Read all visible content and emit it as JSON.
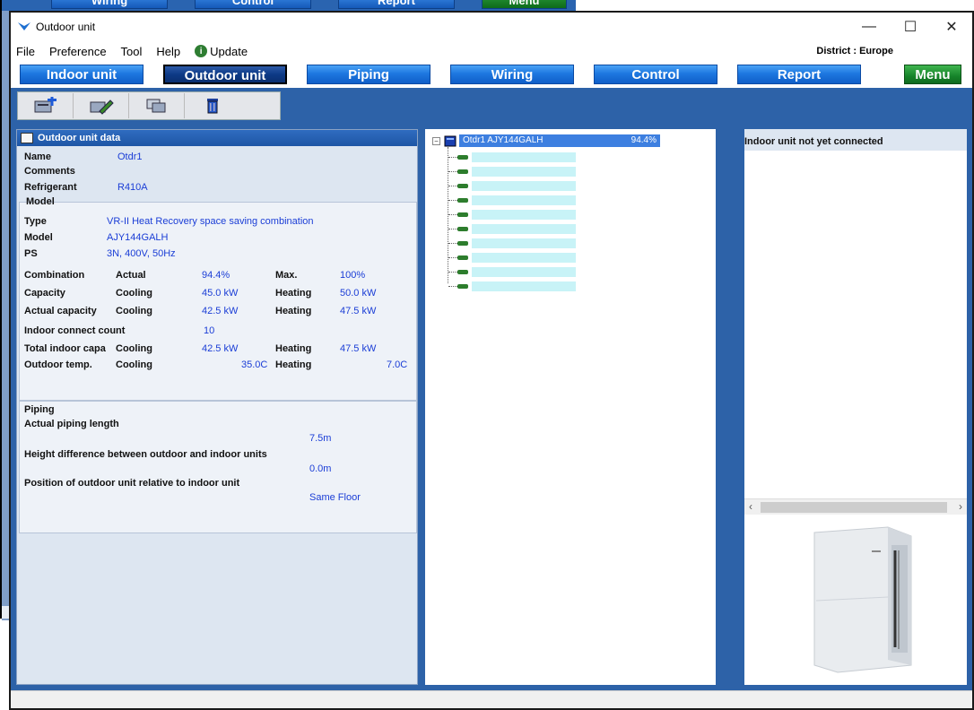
{
  "window": {
    "title": "Outdoor unit",
    "controls": {
      "minimize": "—",
      "maximize": "☐",
      "close": "✕"
    }
  },
  "menubar": {
    "items": [
      "File",
      "Preference",
      "Tool",
      "Help"
    ],
    "update_label": "Update",
    "district": "District : Europe"
  },
  "navbar": {
    "tabs": [
      "Indoor unit",
      "Outdoor unit",
      "Piping",
      "Wiring",
      "Control",
      "Report",
      "Menu"
    ],
    "active": "Outdoor unit"
  },
  "background_window": {
    "buttons": [
      "Wiring",
      "Control",
      "Report",
      "Menu"
    ]
  },
  "toolbar": {
    "icons": [
      "add-unit-icon",
      "edit-unit-icon",
      "copy-unit-icon",
      "delete-icon"
    ]
  },
  "outdoor_data": {
    "header": "Outdoor unit data",
    "name_label": "Name",
    "name_value": "Otdr1",
    "comments_label": "Comments",
    "refrigerant_label": "Refrigerant",
    "refrigerant_value": "R410A",
    "model_section": "Model",
    "type_label": "Type",
    "type_value": "VR-II Heat Recovery space saving combination",
    "model_label": "Model",
    "model_value": "AJY144GALH",
    "ps_label": "PS",
    "ps_value": "3N, 400V, 50Hz",
    "combination_label": "Combination",
    "actual_label": "Actual",
    "combination_actual": "94.4%",
    "max_label": "Max.",
    "combination_max": "100%",
    "capacity_label": "Capacity",
    "cooling_label": "Cooling",
    "capacity_cooling": "45.0 kW",
    "heating_label": "Heating",
    "capacity_heating": "50.0 kW",
    "actual_capacity_label": "Actual capacity",
    "actual_capacity_cooling": "42.5 kW",
    "actual_capacity_heating": "47.5 kW",
    "indoor_count_label": "Indoor connect count",
    "indoor_count_value": "10",
    "total_indoor_label": "Total indoor capa",
    "total_indoor_cooling": "42.5 kW",
    "total_indoor_heating": "47.5 kW",
    "outdoor_temp_label": "Outdoor temp.",
    "outdoor_temp_cooling": "35.0C",
    "outdoor_temp_heating": "7.0C"
  },
  "piping": {
    "section": "Piping",
    "length_label": "Actual piping length",
    "length_value": "7.5m",
    "height_label": "Height difference between outdoor and indoor units",
    "height_value": "0.0m",
    "position_label": "Position of outdoor unit relative to indoor unit",
    "position_value": "Same Floor"
  },
  "tree": {
    "root_label": "Otdr1  AJY144GALH",
    "root_percent": "94.4%",
    "children_count": 10
  },
  "right_panel": {
    "title": "Indoor unit not yet connected"
  },
  "colors": {
    "nav_blue": "#1e78e0",
    "nav_active": "#0d3a86",
    "menu_green": "#16842a",
    "panel_blue": "#2d62a8",
    "value_blue": "#1a3dd6",
    "tree_select": "#3d7fe0"
  }
}
